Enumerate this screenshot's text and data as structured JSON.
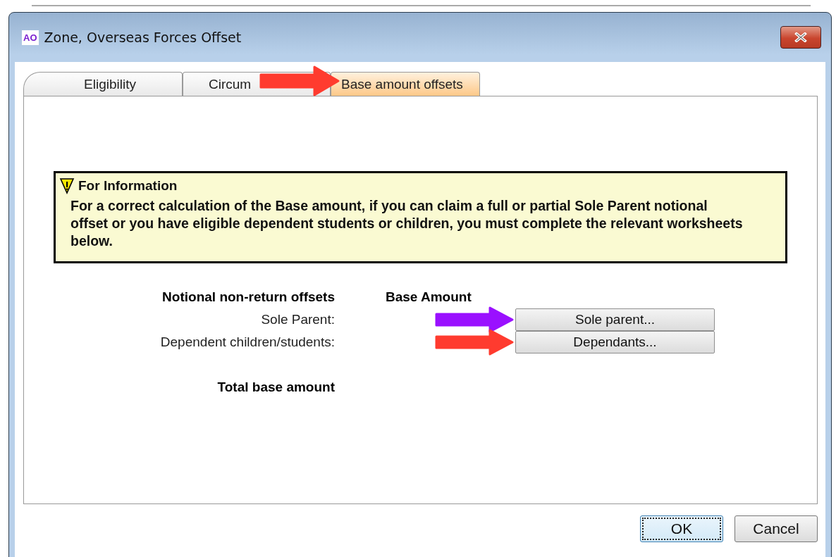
{
  "window": {
    "app_icon": "AO",
    "title": "Zone, Overseas Forces Offset"
  },
  "tabs": [
    {
      "label": "Eligibility",
      "selected": false
    },
    {
      "label": "Circum",
      "selected": false
    },
    {
      "label": "Base amount offsets",
      "selected": true
    }
  ],
  "info": {
    "heading": "For Information",
    "text": "For a correct calculation of the Base amount, if you can claim a full or partial Sole Parent notional offset or you have eligible dependent students or children, you must complete the relevant worksheets below."
  },
  "worksheet": {
    "heading": "Notional non-return offsets",
    "column_heading": "Base Amount",
    "rows": [
      {
        "label": "Sole Parent:",
        "button": "Sole parent..."
      },
      {
        "label": "Dependent children/students:",
        "button": "Dependants..."
      }
    ],
    "total_label": "Total base amount"
  },
  "buttons": [
    {
      "label": "OK",
      "default": true
    },
    {
      "label": "Cancel",
      "default": false
    }
  ],
  "annotations": [
    {
      "color": "#ff3b2f"
    },
    {
      "color": "#9a10ff"
    },
    {
      "color": "#ff3b2f"
    }
  ]
}
